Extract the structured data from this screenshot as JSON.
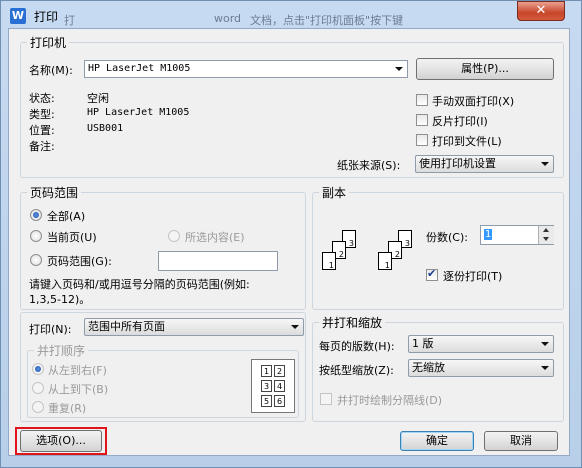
{
  "window": {
    "title": "打印",
    "title_icon": "W",
    "bg_left": "打",
    "bg_word": "word",
    "bg_right": "文档，点击\"打印机面板\"按下键",
    "close_glyph": "✕"
  },
  "printer": {
    "group_title": "打印机",
    "name_label": "名称(M):",
    "name_value": "HP LaserJet M1005",
    "properties_button": "属性(P)...",
    "status_label": "状态:",
    "status_value": "空闲",
    "type_label": "类型:",
    "type_value": "HP LaserJet M1005",
    "location_label": "位置:",
    "location_value": "USB001",
    "comment_label": "备注:",
    "duplex_label": "手动双面打印(X)",
    "reverse_label": "反片打印(I)",
    "print_to_file_label": "打印到文件(L)",
    "paper_source_label": "纸张来源(S):",
    "paper_source_value": "使用打印机设置"
  },
  "page_range": {
    "group_title": "页码范围",
    "all_label": "全部(A)",
    "current_label": "当前页(U)",
    "selection_label": "所选内容(E)",
    "pages_label": "页码范围(G):",
    "pages_value": "",
    "hint": "请键入页码和/或用逗号分隔的页码范围(例如:",
    "hint2": "1,3,5-12)。"
  },
  "copies": {
    "group_title": "副本",
    "count_label": "份数(C):",
    "count_value": "1",
    "collate_label": "逐份打印(T)"
  },
  "print_what": {
    "label": "打印(N):",
    "value": "范围中所有页面"
  },
  "order": {
    "group_title": "并打顺序",
    "ltr_label": "从左到右(F)",
    "ttb_label": "从上到下(B)",
    "repeat_label": "重复(R)",
    "grid_numbers": [
      "1",
      "2",
      "3",
      "4",
      "5",
      "6"
    ]
  },
  "zoom": {
    "group_title": "并打和缩放",
    "pages_per_sheet_label": "每页的版数(H):",
    "pages_per_sheet_value": "1 版",
    "scale_label": "按纸型缩放(Z):",
    "scale_value": "无缩放",
    "separator_label": "并打时绘制分隔线(D)"
  },
  "footer": {
    "options_button": "选项(O)...",
    "ok_button": "确定",
    "cancel_button": "取消"
  },
  "copies_icon_numbers": [
    "3",
    "2",
    "1",
    "3",
    "2",
    "1"
  ],
  "colors": {
    "highlight": "#e0141b",
    "accent": "#2a6fd4"
  }
}
